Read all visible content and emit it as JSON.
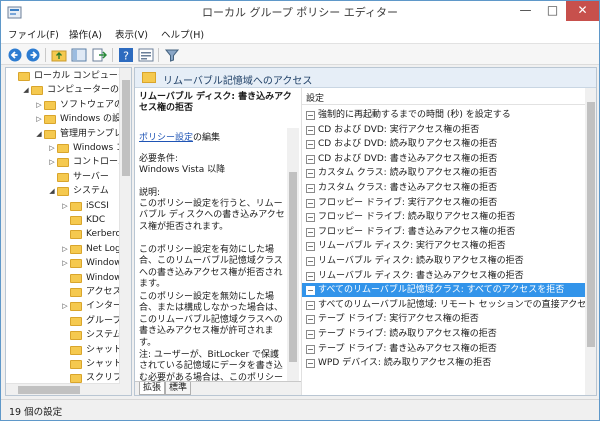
{
  "window": {
    "title": "ローカル グループ ポリシー エディター",
    "min_glyph": "—",
    "max_glyph": "□",
    "close_glyph": "✕"
  },
  "menubar": [
    "ファイル(F)",
    "操作(A)",
    "表示(V)",
    "ヘルプ(H)"
  ],
  "toolbar": {
    "icons": [
      "back-icon",
      "forward-icon",
      "up-folder-icon",
      "show-hide-tree-icon",
      "export-icon",
      "help-icon",
      "properties-icon",
      "filter-icon"
    ]
  },
  "tree": [
    {
      "label": "ローカル コンピューター ポ",
      "level": 0,
      "exp": ""
    },
    {
      "label": "コンピューターの構成",
      "level": 1,
      "exp": "◢"
    },
    {
      "label": "ソフトウェアの設",
      "level": 2,
      "exp": "▷"
    },
    {
      "label": "Windows の設定",
      "level": 2,
      "exp": "▷"
    },
    {
      "label": "管理用テンプレー",
      "level": 2,
      "exp": "◢"
    },
    {
      "label": "Windows コン",
      "level": 3,
      "exp": "▷"
    },
    {
      "label": "コントロール パ",
      "level": 3,
      "exp": "▷"
    },
    {
      "label": "サーバー",
      "level": 3,
      "exp": ""
    },
    {
      "label": "システム",
      "level": 3,
      "exp": "◢"
    },
    {
      "label": "iSCSI",
      "level": 4,
      "exp": "▷"
    },
    {
      "label": "KDC",
      "level": 4,
      "exp": ""
    },
    {
      "label": "Kerberos",
      "level": 4,
      "exp": ""
    },
    {
      "label": "Net Logon",
      "level": 4,
      "exp": "▷"
    },
    {
      "label": "Windows",
      "level": 4,
      "exp": "▷"
    },
    {
      "label": "Windows",
      "level": 4,
      "exp": ""
    },
    {
      "label": "アクセス",
      "level": 4,
      "exp": ""
    },
    {
      "label": "インターネ",
      "level": 4,
      "exp": "▷"
    },
    {
      "label": "グループ",
      "level": 4,
      "exp": ""
    },
    {
      "label": "システム",
      "level": 4,
      "exp": ""
    },
    {
      "label": "シャット",
      "level": 4,
      "exp": ""
    },
    {
      "label": "シャット",
      "level": 4,
      "exp": ""
    },
    {
      "label": "スクリプ",
      "level": 4,
      "exp": ""
    }
  ],
  "panel": {
    "header": "リムーバブル記憶域へのアクセス",
    "desc_title": "リムーバブル ディスク: 書き込みアクセス権の拒否",
    "link_text": "ポリシー設定",
    "link_suffix": "の編集",
    "req_label": "必要条件:",
    "req_value": "Windows Vista 以降",
    "expl_label": "説明:",
    "para1": "このポリシー設定を行うと、リムーバブル ディスクへの書き込みアクセス権が拒否されます。",
    "para2": "このポリシー設定を有効にした場合、このリムーバブル記憶域クラスへの書き込みアクセス権が拒否されます。",
    "para3": "このポリシー設定を無効にした場合、または構成しなかった場合は、このリムーバブル記憶域クラスへの書き込みアクセス権が許可されます。",
    "para4": "注: ユーザーが、BitLocker で保護されている記憶域にデータを書き込む必要がある場合は、このポリシーの設定",
    "tab_extended": "拡張",
    "tab_standard": "標準"
  },
  "list": {
    "header": "設定",
    "selected_index": 12,
    "rows": [
      "強制的に再起動するまでの時間 (秒) を設定する",
      "CD および DVD: 実行アクセス権の拒否",
      "CD および DVD: 読み取りアクセス権の拒否",
      "CD および DVD: 書き込みアクセス権の拒否",
      "カスタム クラス: 読み取りアクセス権の拒否",
      "カスタム クラス: 書き込みアクセス権の拒否",
      "フロッピー ドライブ: 実行アクセス権の拒否",
      "フロッピー ドライブ: 読み取りアクセス権の拒否",
      "フロッピー ドライブ: 書き込みアクセス権の拒否",
      "リムーバブル ディスク: 実行アクセス権の拒否",
      "リムーバブル ディスク: 読み取りアクセス権の拒否",
      "リムーバブル ディスク: 書き込みアクセス権の拒否",
      "すべてのリムーバブル記憶域クラス: すべてのアクセスを拒否",
      "すべてのリムーバブル記憶域: リモート セッションでの直接アクセスを...",
      "テープ ドライブ: 実行アクセス権の拒否",
      "テープ ドライブ: 読み取りアクセス権の拒否",
      "テープ ドライブ: 書き込みアクセス権の拒否",
      "WPD デバイス: 読み取りアクセス権の拒否"
    ]
  },
  "status": "19 個の設定"
}
